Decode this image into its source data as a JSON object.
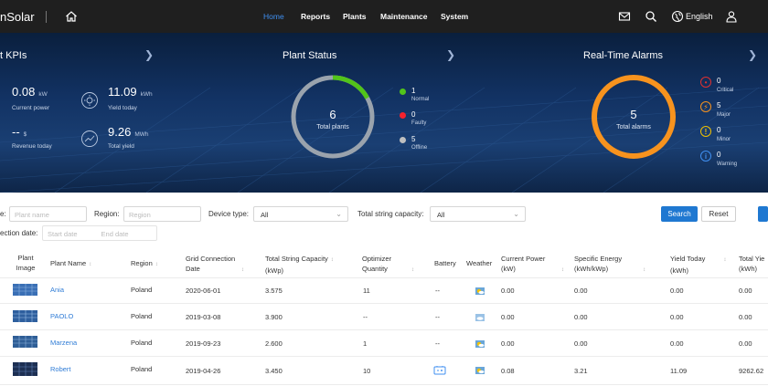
{
  "topbar": {
    "brand": "nSolar",
    "nav": [
      {
        "label": "Home",
        "active": true
      },
      {
        "label": "Reports",
        "active": false
      },
      {
        "label": "Plants",
        "active": false
      },
      {
        "label": "Maintenance",
        "active": false
      },
      {
        "label": "System",
        "active": false
      }
    ],
    "language": "English",
    "icons": [
      "home-icon",
      "mail-icon",
      "search-icon",
      "globe-icon",
      "user-icon"
    ]
  },
  "kpis": {
    "title": "t KPIs",
    "items": [
      {
        "value": "0.08",
        "unit": "kW",
        "label": "Current power"
      },
      {
        "value": "11.09",
        "unit": "kWh",
        "label": "Yield today"
      },
      {
        "value": "--",
        "unit": "$",
        "label": "Revenue today"
      },
      {
        "value": "9.26",
        "unit": "MWh",
        "label": "Total yield"
      }
    ]
  },
  "plant_status": {
    "title": "Plant Status",
    "total": "6",
    "total_label": "Total plants",
    "normal_fraction": 0.17,
    "legend": [
      {
        "count": "1",
        "label": "Normal",
        "color": "#52c41a"
      },
      {
        "count": "0",
        "label": "Faulty",
        "color": "#f5222d"
      },
      {
        "count": "5",
        "label": "Offline",
        "color": "#bfbfbf"
      }
    ]
  },
  "alarms": {
    "title": "Real-Time Alarms",
    "total": "5",
    "total_label": "Total alarms",
    "ring_color": "#f7931e",
    "legend": [
      {
        "count": "0",
        "label": "Critical",
        "color": "#e03030"
      },
      {
        "count": "5",
        "label": "Major",
        "color": "#f7931e"
      },
      {
        "count": "0",
        "label": "Minor",
        "color": "#f2c200"
      },
      {
        "count": "0",
        "label": "Warning",
        "color": "#3f8ff0"
      }
    ]
  },
  "filters": {
    "plant_name_label": "e:",
    "plant_name_placeholder": "Plant name",
    "region_label": "Region:",
    "region_placeholder": "Region",
    "device_type_label": "Device type:",
    "device_type_value": "All",
    "capacity_label": "Total string capacity:",
    "capacity_value": "All",
    "connection_date_label": "ection date:",
    "start_placeholder": "Start date",
    "end_placeholder": "End date",
    "search_label": "Search",
    "reset_label": "Reset"
  },
  "table": {
    "headers": {
      "image": [
        "Plant",
        "Image"
      ],
      "name": "Plant Name",
      "region": "Region",
      "grid_date": [
        "Grid Connection",
        "Date"
      ],
      "capacity": [
        "Total String Capacity",
        "(kWp)"
      ],
      "optimizer": [
        "Optimizer",
        "Quantity"
      ],
      "battery": "Battery",
      "weather": "Weather",
      "power": [
        "Current Power",
        "(kW)"
      ],
      "specific": [
        "Specific Energy",
        "(kWh/kWp)"
      ],
      "yield_today": [
        "Yield Today",
        "(kWh)"
      ],
      "total_yield": [
        "Total Yie",
        "(kWh)"
      ]
    },
    "rows": [
      {
        "name": "Ania",
        "region": "Poland",
        "date": "2020-06-01",
        "capacity": "3.575",
        "optimizer": "11",
        "battery": "--",
        "power": "0.00",
        "specific": "0.00",
        "yield_today": "0.00",
        "total_yield": "0.00"
      },
      {
        "name": "PAOLO",
        "region": "Poland",
        "date": "2019-03-08",
        "capacity": "3.900",
        "optimizer": "--",
        "battery": "--",
        "power": "0.00",
        "specific": "0.00",
        "yield_today": "0.00",
        "total_yield": "0.00"
      },
      {
        "name": "Marzena",
        "region": "Poland",
        "date": "2019-09-23",
        "capacity": "2.600",
        "optimizer": "1",
        "battery": "--",
        "power": "0.00",
        "specific": "0.00",
        "yield_today": "0.00",
        "total_yield": "0.00"
      },
      {
        "name": "Robert",
        "region": "Poland",
        "date": "2019-04-26",
        "capacity": "3.450",
        "optimizer": "10",
        "battery": "",
        "power": "0.08",
        "specific": "3.21",
        "yield_today": "11.09",
        "total_yield": "9262.62"
      }
    ]
  }
}
